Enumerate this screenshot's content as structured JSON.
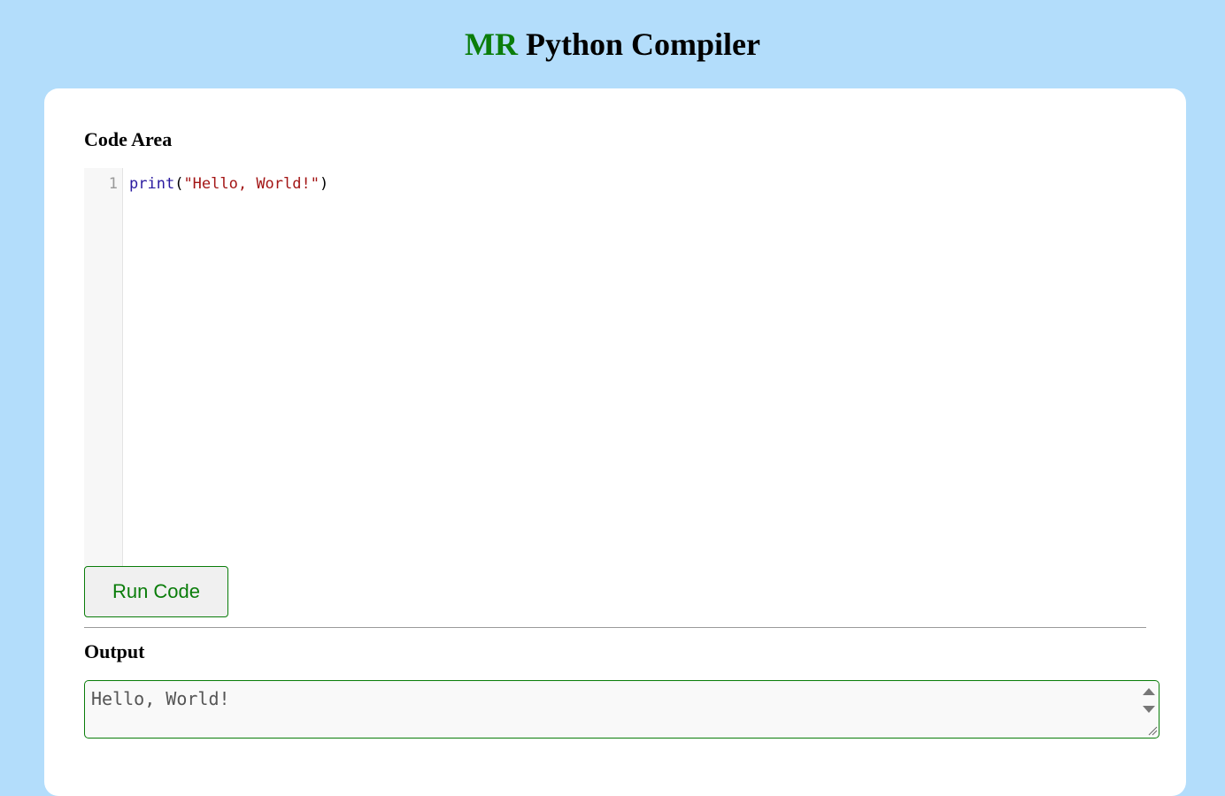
{
  "header": {
    "brand": "MR",
    "title_rest": " Python Compiler",
    "brand_color": "#0a7d0a"
  },
  "code_area": {
    "label": "Code Area",
    "lines": [
      {
        "number": "1",
        "tokens": {
          "builtin": "print",
          "open_paren": "(",
          "string": "\"Hello, World!\"",
          "close_paren": ")"
        }
      }
    ]
  },
  "run_button": {
    "label": "Run Code"
  },
  "output": {
    "label": "Output",
    "value": "Hello, World!"
  },
  "colors": {
    "background": "#b3ddfb",
    "accent": "#0a7d0a",
    "card": "#ffffff"
  },
  "icons": {
    "scroll_up": "arrow-up-icon",
    "scroll_down": "arrow-down-icon",
    "resize": "resize-handle-icon"
  }
}
